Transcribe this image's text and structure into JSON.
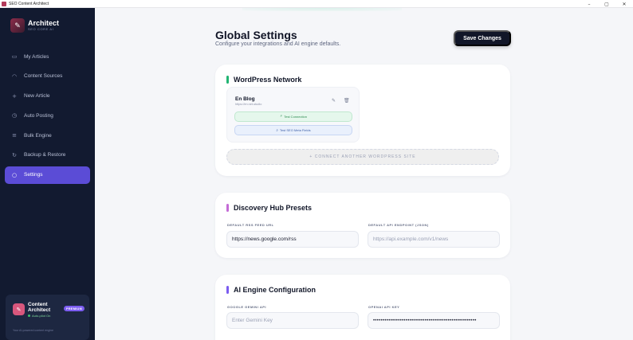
{
  "window": {
    "title": "SEO Content Architect",
    "controls": {
      "minimize": "–",
      "maximize": "▢",
      "close": "✕"
    }
  },
  "brand": {
    "name": "Architect",
    "subtitle": "SEO CORE AI",
    "logo_icon": "feather-icon"
  },
  "sidebar": {
    "items": [
      {
        "label": "My Articles",
        "icon": "folder-icon",
        "glyph": "▭",
        "active": false
      },
      {
        "label": "Content Sources",
        "icon": "rss-icon",
        "glyph": "◠",
        "active": false
      },
      {
        "label": "New Article",
        "icon": "plus-icon",
        "glyph": "+",
        "active": false
      },
      {
        "label": "Auto Posting",
        "icon": "clock-icon",
        "glyph": "◷",
        "active": false
      },
      {
        "label": "Bulk Engine",
        "icon": "layers-icon",
        "glyph": "≡",
        "active": false
      },
      {
        "label": "Backup & Restore",
        "icon": "refresh-icon",
        "glyph": "↻",
        "active": false
      },
      {
        "label": "Settings",
        "icon": "settings-icon",
        "glyph": "○",
        "active": true
      }
    ]
  },
  "promo": {
    "title": "Content Architect",
    "badge": "PREMIUM",
    "status": "Auto-pilot On",
    "footer": "Your AI-powered content engine",
    "icon": "edit-icon"
  },
  "header": {
    "title": "Global Settings",
    "subtitle": "Configure your integrations and AI engine defaults.",
    "save_label": "Save Changes"
  },
  "wordpress": {
    "title": "WordPress Network",
    "accent": "#22b573",
    "sites": [
      {
        "name": "En Blog",
        "url": "https://en.net-studio",
        "test_label": "Test Connection",
        "meta_label": "Test SEO Meta Fields"
      }
    ],
    "connect_label": "+ CONNECT ANOTHER WORDPRESS SITE"
  },
  "discovery": {
    "title": "Discovery Hub Presets",
    "accent": "#c46bd6",
    "rss_label": "DEFAULT RSS FEED URL",
    "rss_value": "https://news.google.com/rss",
    "api_label": "DEFAULT API ENDPOINT (JSON)",
    "api_placeholder": "https://api.example.com/v1/news"
  },
  "ai_engine": {
    "title": "AI Engine Configuration",
    "accent": "#7b5cf0",
    "gemini_label": "GOOGLE GEMINI API",
    "gemini_placeholder": "Enter Gemini Key",
    "openai_label": "OPENAI API KEY",
    "openai_value": "••••••••••••••••••••••••••••••••••••••••••••••••••••••"
  }
}
